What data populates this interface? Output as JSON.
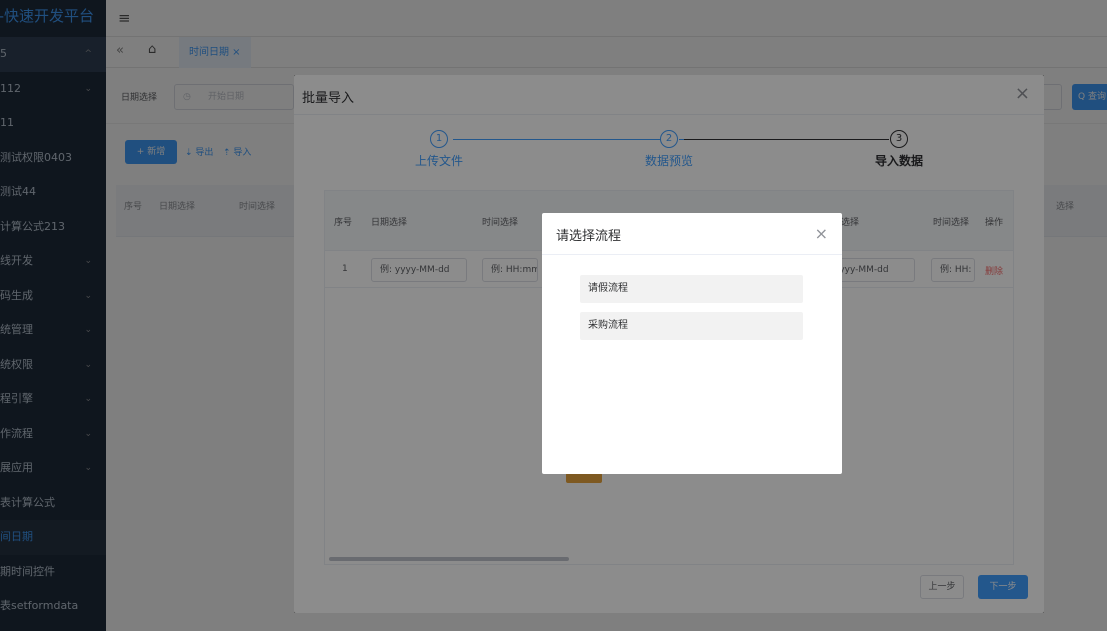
{
  "sidebar": {
    "logo": "F-快速开发平台",
    "items": [
      {
        "label": "5",
        "arrow": "^"
      },
      {
        "label": "112",
        "arrow": "⌄"
      },
      {
        "label": "11",
        "arrow": ""
      },
      {
        "label": "测试权限0403",
        "arrow": ""
      },
      {
        "label": "测试44",
        "arrow": ""
      },
      {
        "label": "计算公式213",
        "arrow": ""
      },
      {
        "label": "线开发",
        "arrow": "⌄"
      },
      {
        "label": "码生成",
        "arrow": "⌄"
      },
      {
        "label": "统管理",
        "arrow": "⌄"
      },
      {
        "label": "统权限",
        "arrow": "⌄"
      },
      {
        "label": "程引擎",
        "arrow": "⌄"
      },
      {
        "label": "作流程",
        "arrow": "⌄"
      },
      {
        "label": "展应用",
        "arrow": "⌄"
      },
      {
        "label": "表计算公式",
        "arrow": ""
      },
      {
        "label": "间日期",
        "arrow": ""
      },
      {
        "label": "期时间控件",
        "arrow": ""
      },
      {
        "label": "表setformdata",
        "arrow": ""
      }
    ]
  },
  "topbar": {
    "menu_icon": "≡"
  },
  "tabs": {
    "back_icon": "«",
    "home_icon": "⌂",
    "active_tab": "时间日期 ×"
  },
  "search": {
    "date_label": "日期选择",
    "date_placeholder": "开始日期",
    "search_btn": "Q 查询"
  },
  "toolbar": {
    "add_label": "+ 新增",
    "export_label": "⇣ 导出",
    "import_label": "⇡ 导入"
  },
  "base_table": {
    "headers": [
      "序号",
      "日期选择",
      "时间选择",
      "选择"
    ]
  },
  "import_dialog": {
    "title": "批量导入",
    "close": "×",
    "steps": [
      {
        "num": "1",
        "title": "上传文件"
      },
      {
        "num": "2",
        "title": "数据预览"
      },
      {
        "num": "3",
        "title": "导入数据"
      }
    ],
    "table_headers": [
      "序号",
      "日期选择",
      "时间选择",
      "选择",
      "时间选择",
      "操作"
    ],
    "row": {
      "index": "1",
      "date_ph": "例: yyyy-MM-dd",
      "time_ph": "例: HH:mm",
      "date_ph2": "yyyy-MM-dd",
      "time_ph2": "例: HH:",
      "delete": "删除"
    },
    "prev_btn": "上一步",
    "next_btn": "下一步"
  },
  "flow_dialog": {
    "title": "请选择流程",
    "close": "×",
    "options": [
      "请假流程",
      "采购流程"
    ]
  }
}
